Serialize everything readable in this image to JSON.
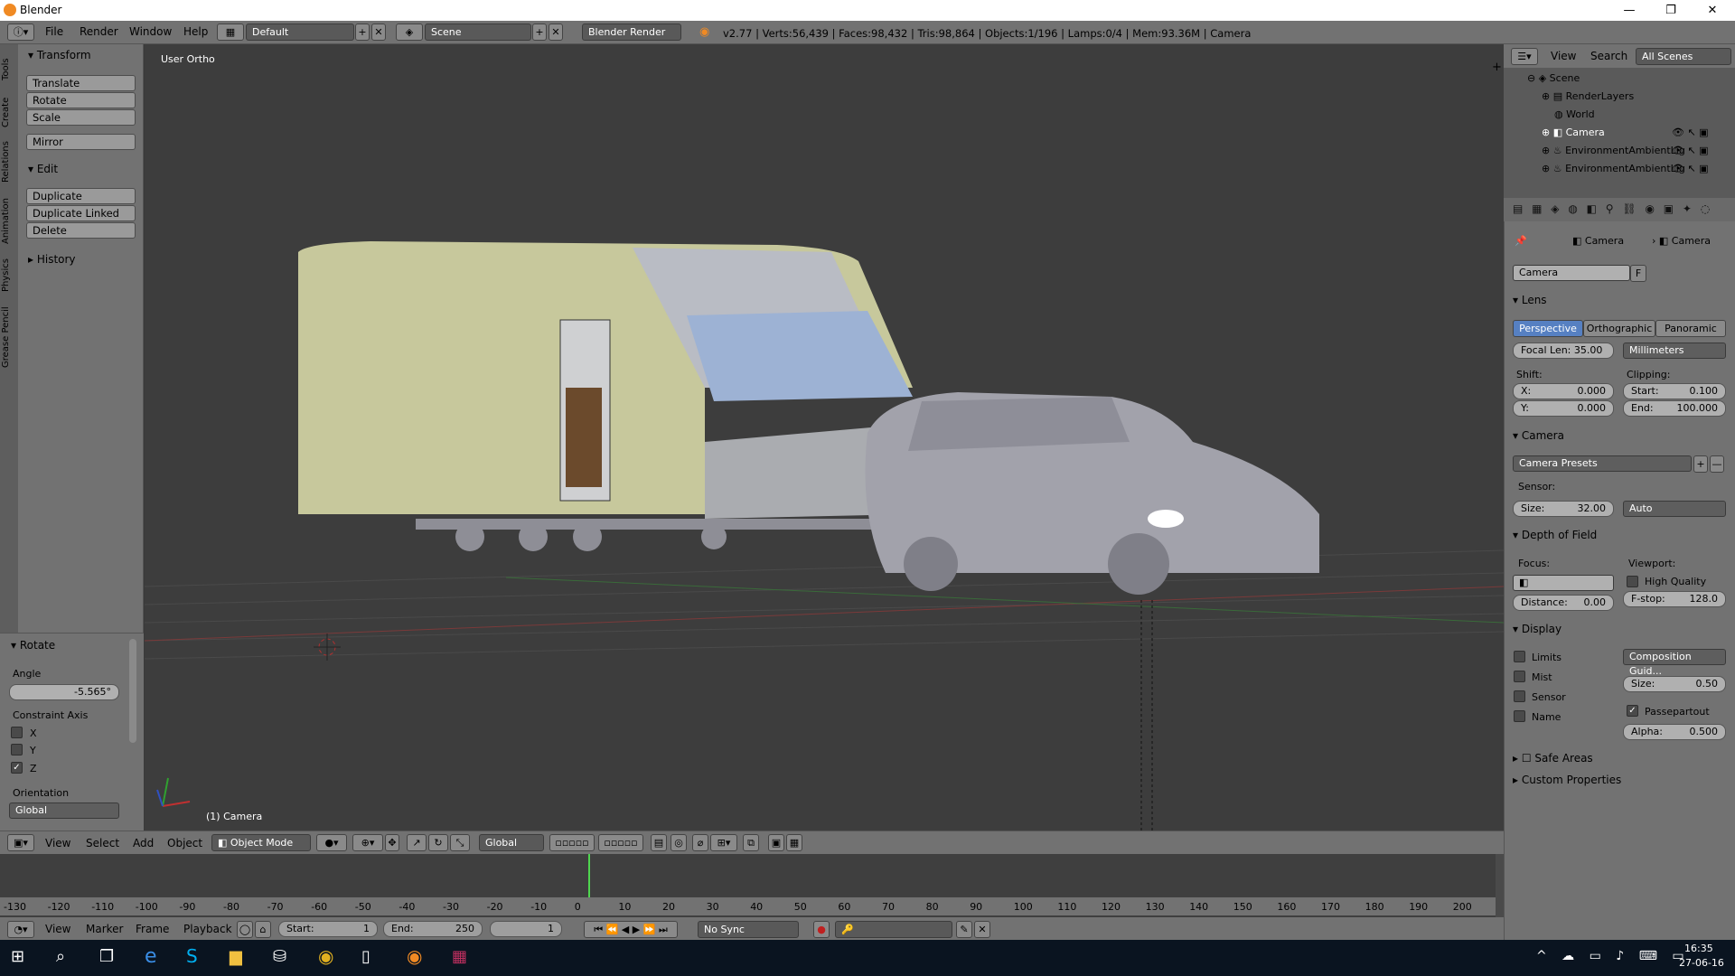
{
  "app": {
    "title": "Blender",
    "window_controls": [
      "—",
      "❐",
      "✕"
    ]
  },
  "topbar": {
    "menus": [
      "File",
      "Render",
      "Window",
      "Help"
    ],
    "layout": "Default",
    "scene": "Scene",
    "engine": "Blender Render",
    "stats": "v2.77 | Verts:56,439 | Faces:98,432 | Tris:98,864 | Objects:1/196 | Lamps:0/4 | Mem:93.36M | Camera"
  },
  "toolshelf": {
    "tabs": [
      "Tools",
      "Create",
      "Relations",
      "Animation",
      "Physics",
      "Grease Pencil"
    ],
    "transform": {
      "header": "Transform",
      "buttons": [
        "Translate",
        "Rotate",
        "Scale",
        "Mirror"
      ]
    },
    "edit": {
      "header": "Edit",
      "buttons": [
        "Duplicate",
        "Duplicate Linked",
        "Delete"
      ]
    },
    "history": {
      "header": "History"
    },
    "operator": {
      "header": "Rotate",
      "angle_label": "Angle",
      "angle_value": "-5.565°",
      "constraint_label": "Constraint Axis",
      "axes": [
        "X",
        "Y",
        "Z"
      ],
      "z_checked": true,
      "orientation_label": "Orientation",
      "orientation_value": "Global"
    }
  },
  "viewport": {
    "view_label": "User Ortho",
    "object_label": "(1) Camera"
  },
  "header3d": {
    "menus": [
      "View",
      "Select",
      "Add",
      "Object"
    ],
    "mode": "Object Mode",
    "orientation": "Global"
  },
  "timeline": {
    "ticks": [
      "-130",
      "-120",
      "-110",
      "-100",
      "-90",
      "-80",
      "-70",
      "-60",
      "-50",
      "-40",
      "-30",
      "-20",
      "-10",
      "0",
      "10",
      "20",
      "30",
      "40",
      "50",
      "60",
      "70",
      "80",
      "90",
      "100",
      "110",
      "120",
      "130",
      "140",
      "150",
      "160",
      "170",
      "180",
      "190",
      "200"
    ],
    "menus": [
      "View",
      "Marker",
      "Frame",
      "Playback"
    ],
    "start": "Start:",
    "start_val": "1",
    "end": "End:",
    "end_val": "250",
    "current": "1",
    "sync": "No Sync"
  },
  "outliner": {
    "menus": [
      "View",
      "Search"
    ],
    "filter": "All Scenes",
    "items": [
      "Scene",
      "RenderLayers",
      "World",
      "Camera",
      "EnvironmentAmbientLig",
      "EnvironmentAmbientLig"
    ]
  },
  "properties": {
    "breadcrumb": [
      "Camera",
      "Camera"
    ],
    "datablock": "Camera",
    "fake_user": "F",
    "lens": {
      "header": "Lens",
      "tabs": [
        "Perspective",
        "Orthographic",
        "Panoramic"
      ],
      "focal": "Focal Len: 35.00",
      "units": "Millimeters",
      "shift": "Shift:",
      "clipping": "Clipping:",
      "shift_x": "X:",
      "shift_x_val": "0.000",
      "shift_y": "Y:",
      "shift_y_val": "0.000",
      "clip_start": "Start:",
      "clip_start_val": "0.100",
      "clip_end": "End:",
      "clip_end_val": "100.000"
    },
    "camera": {
      "header": "Camera",
      "presets": "Camera Presets",
      "sensor": "Sensor:",
      "size": "Size:",
      "size_val": "32.00",
      "fit": "Auto"
    },
    "dof": {
      "header": "Depth of Field",
      "focus": "Focus:",
      "viewport": "Viewport:",
      "hq": "High Quality",
      "distance": "Distance:",
      "distance_val": "0.00",
      "fstop": "F-stop:",
      "fstop_val": "128.0"
    },
    "display": {
      "header": "Display",
      "limits": "Limits",
      "mist": "Mist",
      "sensor": "Sensor",
      "name": "Name",
      "guides": "Composition Guid...",
      "size": "Size:",
      "size_val": "0.50",
      "passepartout": "Passepartout",
      "alpha": "Alpha:",
      "alpha_val": "0.500"
    },
    "safe_areas": "Safe Areas",
    "custom_props": "Custom Properties"
  },
  "taskbar": {
    "time": "16:35",
    "date": "27-06-16"
  }
}
